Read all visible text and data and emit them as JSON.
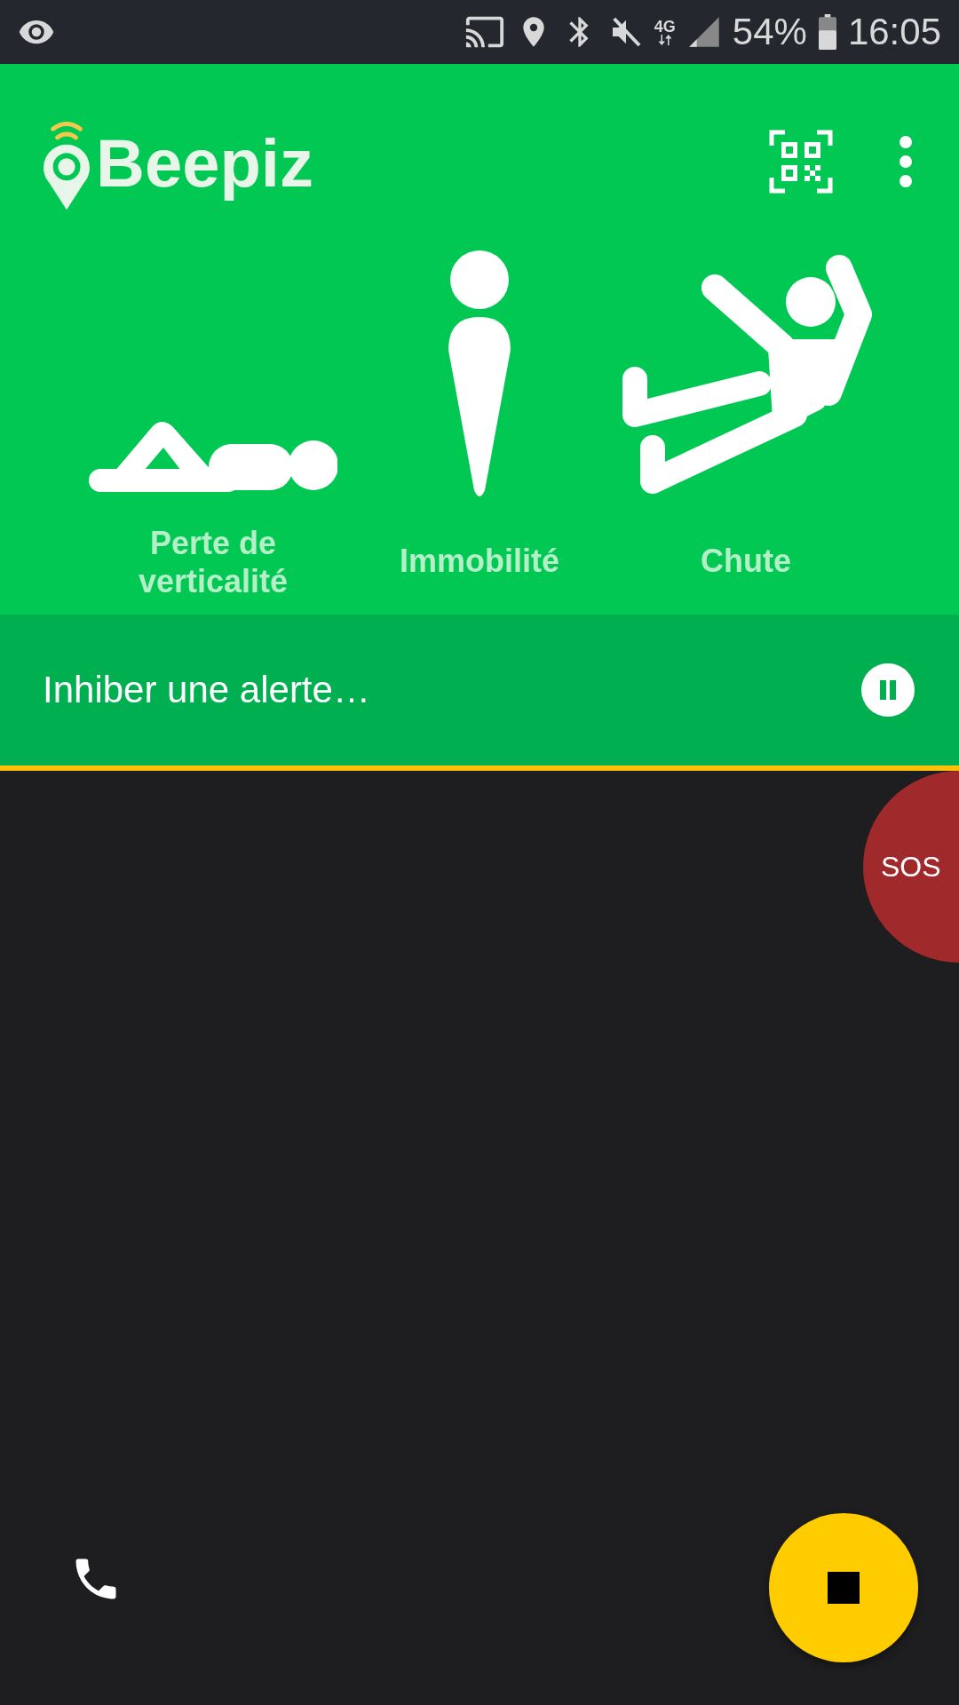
{
  "status_bar": {
    "network": "4G",
    "battery": "54%",
    "time": "16:05"
  },
  "app_bar": {
    "title": "Beepiz"
  },
  "alert_types": [
    {
      "kind": "lying",
      "label": "Perte de verticalité"
    },
    {
      "kind": "standing",
      "label": "Immobilité"
    },
    {
      "kind": "falling",
      "label": "Chute"
    }
  ],
  "inhibit_bar": {
    "label": "Inhiber une alerte…"
  },
  "sos_button": {
    "label": "SOS"
  }
}
